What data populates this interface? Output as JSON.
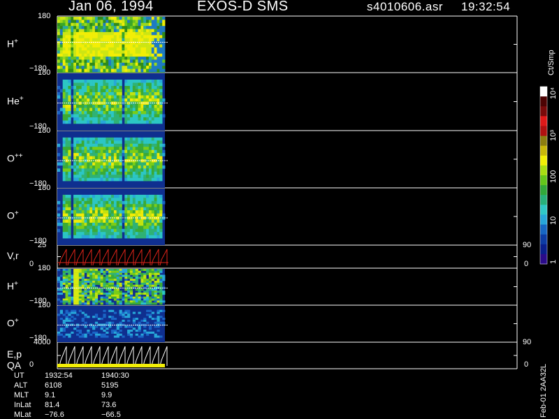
{
  "header": {
    "date": "Jan 06, 1994",
    "mission": "EXOS-D SMS",
    "file": "s4010606.asr",
    "time": "19:32:54"
  },
  "panels": [
    {
      "label": "H",
      "sup": "+",
      "top_tick": "180",
      "bottom_tick": "−180"
    },
    {
      "label": "He",
      "sup": "+",
      "top_tick": "180",
      "bottom_tick": "−180"
    },
    {
      "label": "O",
      "sup": "++",
      "top_tick": "180",
      "bottom_tick": "−180"
    },
    {
      "label": "O",
      "sup": "+",
      "top_tick": "180",
      "bottom_tick": "−180"
    },
    {
      "label": "V,r",
      "sup": "",
      "top_tick": "25",
      "bottom_tick": "0",
      "right_top": "90",
      "right_bottom": "0"
    },
    {
      "label": "H",
      "sup": "+",
      "top_tick": "180",
      "bottom_tick": "−180"
    },
    {
      "label": "O",
      "sup": "+",
      "top_tick": "180",
      "bottom_tick": "−180"
    },
    {
      "label": "E,p",
      "label2": "QA",
      "sup": "",
      "top_tick": "4000",
      "bottom_tick": "0",
      "right_top": "90",
      "right_bottom": "0"
    }
  ],
  "colorbar": {
    "unit": "Ct/Smp",
    "labels": [
      "10⁴",
      "10³",
      "100",
      "10",
      "1"
    ],
    "colors": [
      "#2b0b8a",
      "#0a1f8c",
      "#0d3ca3",
      "#1767c2",
      "#27a6d8",
      "#2fc7c5",
      "#27b07a",
      "#31a83a",
      "#64c61b",
      "#a8dd12",
      "#f2ee06",
      "#c9b70a",
      "#8c7d10",
      "#b01010",
      "#e01919",
      "#7a0a0a",
      "#4d0303",
      "#ffffff"
    ]
  },
  "info": {
    "rows": [
      {
        "name": "UT",
        "v1": "1932:54",
        "v2": "1940:30"
      },
      {
        "name": "ALT",
        "v1": "6108",
        "v2": "5195"
      },
      {
        "name": "MLT",
        "v1": "9.1",
        "v2": "9.9"
      },
      {
        "name": "InLat",
        "v1": "81.4",
        "v2": "73.6"
      },
      {
        "name": "MLat",
        "v1": "−76.6",
        "v2": "−66.5"
      }
    ]
  },
  "version": "Feb-01 2AA32L",
  "chart_data": {
    "type": "heatmap",
    "title": "Jan 06, 1994   EXOS-D SMS",
    "xlabel": "UT",
    "x_start": "1932:54",
    "x_end": "1940:30",
    "panels": [
      {
        "name": "H+",
        "ylim": [
          -180,
          180
        ]
      },
      {
        "name": "He+",
        "ylim": [
          -180,
          180
        ]
      },
      {
        "name": "O++",
        "ylim": [
          -180,
          180
        ]
      },
      {
        "name": "O+",
        "ylim": [
          -180,
          180
        ]
      },
      {
        "name": "V,r",
        "ylim": [
          0,
          25
        ],
        "ylim_right": [
          0,
          90
        ]
      },
      {
        "name": "H+",
        "ylim": [
          -180,
          180
        ]
      },
      {
        "name": "O+",
        "ylim": [
          -180,
          180
        ]
      },
      {
        "name": "E,p / QA",
        "ylim": [
          0,
          4000
        ],
        "ylim_right": [
          0,
          90
        ]
      }
    ],
    "colorbar_unit": "Ct/Smp",
    "colorbar_scale": "log",
    "colorbar_range": [
      1,
      10000
    ]
  }
}
